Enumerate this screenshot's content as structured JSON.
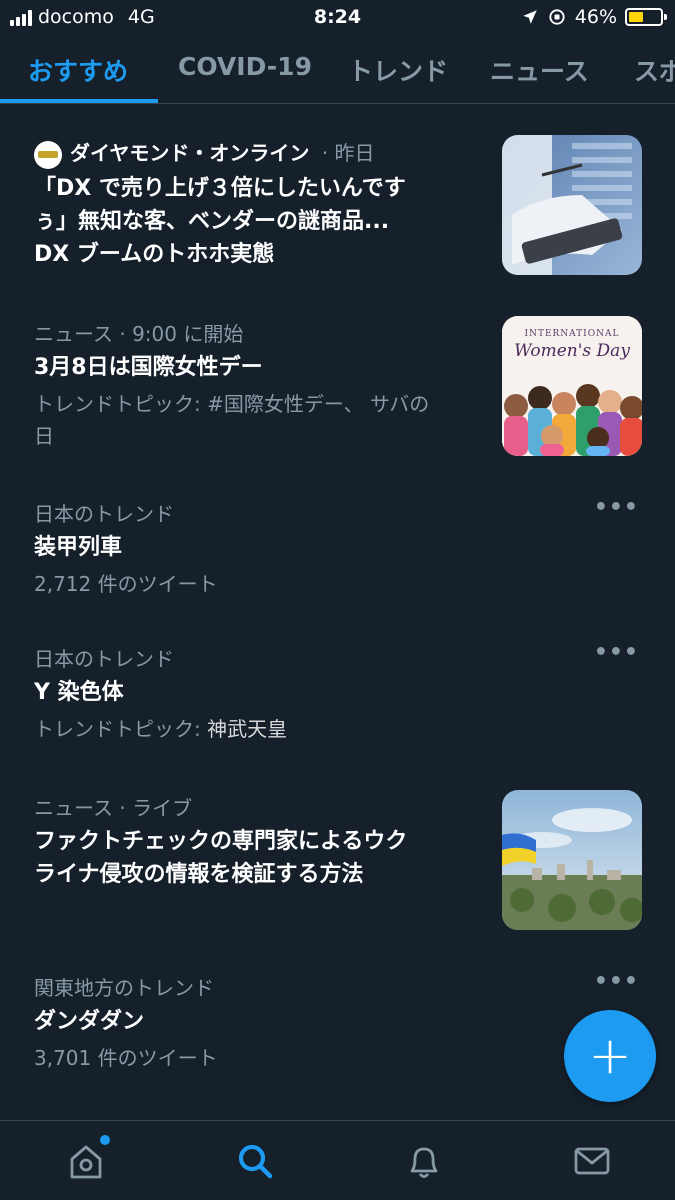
{
  "status_bar": {
    "carrier": "docomo",
    "network": "4G",
    "time": "8:24",
    "battery": "46%",
    "battery_level": 0.46
  },
  "tabs": [
    {
      "label": "おすすめ",
      "active": true
    },
    {
      "label": "COVID-19",
      "active": false
    },
    {
      "label": "トレンド",
      "active": false
    },
    {
      "label": "ニュース",
      "active": false
    },
    {
      "label": "スポ",
      "active": false
    }
  ],
  "feed": {
    "items": [
      {
        "source": "ダイヤモンド・オンライン",
        "time": "· 昨日",
        "title_lines": [
          "「DX で売り上げ３倍にしたいんです",
          "ぅ」無知な客、ベンダーの謎商品...",
          "DX ブームのトホホ実態"
        ],
        "thumb": "server-room-photo"
      },
      {
        "category": "ニュース",
        "time": "· 9:00 に開始",
        "title": "3月8日は国際女性デー",
        "sub_lines": [
          "トレンドトピック: #国際女性デー、 サバの",
          "日"
        ],
        "thumb": "womens-day-illustration",
        "thumb_text_top": "INTERNATIONAL",
        "thumb_text_main": "Women's Day"
      },
      {
        "category": "日本のトレンド",
        "title": "装甲列車",
        "sub": "2,712 件のツイート"
      },
      {
        "category": "日本のトレンド",
        "title": "Y 染色体",
        "sub_label": "トレンドトピック: ",
        "sub_value": "神武天皇"
      },
      {
        "category": "ニュース",
        "time": "· ライブ",
        "title_lines": [
          "ファクトチェックの専門家によるウク",
          "ライナ侵攻の情報を検証する方法"
        ],
        "thumb": "kyiv-city-photo"
      },
      {
        "category": "関東地方のトレンド",
        "title": "ダンダダン",
        "sub": "3,701 件のツイート"
      }
    ],
    "more_label": "•••"
  },
  "fab": {
    "label": "+"
  },
  "bottom_nav": [
    {
      "name": "home-icon"
    },
    {
      "name": "search-icon",
      "active": true
    },
    {
      "name": "bell-icon"
    },
    {
      "name": "mail-icon"
    }
  ],
  "colors": {
    "background": "#15202b",
    "accent": "#1d9bf0",
    "secondary_text": "#8899a6",
    "divider": "#38444d"
  }
}
